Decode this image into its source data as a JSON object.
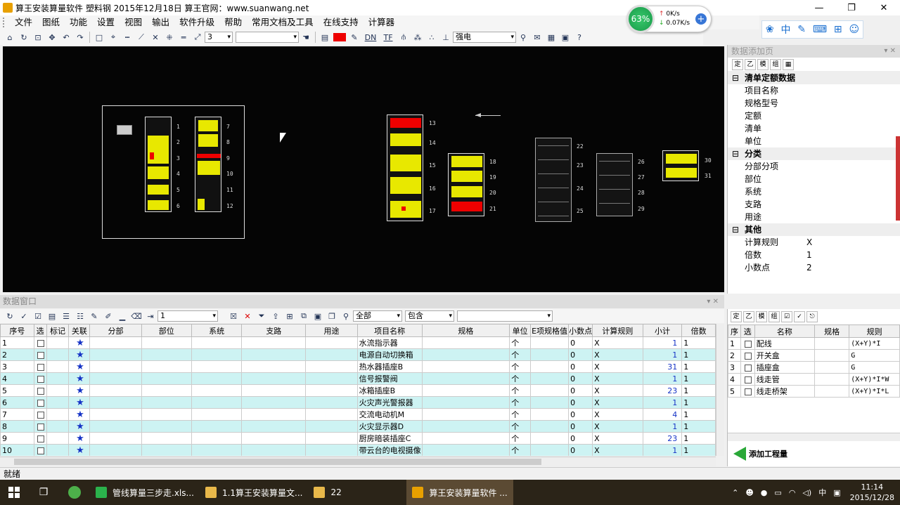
{
  "window": {
    "title": "算王安装算量软件 塑料钢 2015年12月18日  算王官网：www.suanwang.net",
    "min_label": "—",
    "restore_label": "❐",
    "close_label": "✕"
  },
  "menu": [
    "文件",
    "图纸",
    "功能",
    "设置",
    "视图",
    "输出",
    "软件升级",
    "帮助",
    "常用文档及工具",
    "在线支持",
    "计算器"
  ],
  "toolbar": {
    "layer_value": "3",
    "type_value": "强电",
    "dn_label": "DN",
    "tf_label": "TF"
  },
  "network": {
    "percent": "63%",
    "up": "0K/s",
    "down": "0.07K/s"
  },
  "ime": {
    "lang": "中"
  },
  "drawing": {
    "sheet_numbers": [
      "1",
      "2",
      "3",
      "4",
      "5",
      "6",
      "7",
      "8",
      "9",
      "10",
      "11",
      "12",
      "13",
      "14",
      "15",
      "16",
      "17",
      "18",
      "19",
      "20",
      "21",
      "22",
      "23",
      "24",
      "25",
      "26",
      "27",
      "28",
      "29",
      "30",
      "31"
    ]
  },
  "right_panel": {
    "title": "数据添加页",
    "tool_labels": [
      "定",
      "乙",
      "模",
      "组"
    ],
    "groups": [
      {
        "name": "清单定额数据",
        "rows": [
          {
            "k": "项目名称",
            "v": ""
          },
          {
            "k": "规格型号",
            "v": ""
          },
          {
            "k": "定额",
            "v": ""
          },
          {
            "k": "清单",
            "v": ""
          },
          {
            "k": "单位",
            "v": ""
          }
        ]
      },
      {
        "name": "分类",
        "rows": [
          {
            "k": "分部分项",
            "v": ""
          },
          {
            "k": "部位",
            "v": ""
          },
          {
            "k": "系统",
            "v": ""
          },
          {
            "k": "支路",
            "v": ""
          },
          {
            "k": "用途",
            "v": ""
          }
        ]
      },
      {
        "name": "其他",
        "rows": [
          {
            "k": "计算规则",
            "v": "X"
          },
          {
            "k": "倍数",
            "v": "1"
          },
          {
            "k": "小数点",
            "v": "2"
          }
        ]
      }
    ]
  },
  "data_window": {
    "title": "数据窗口",
    "page_value": "1",
    "filter_value": "全部",
    "match_value": "包含",
    "columns": [
      "序号",
      "选",
      "标记",
      "关联",
      "分部",
      "部位",
      "系统",
      "支路",
      "用途",
      "项目名称",
      "规格",
      "单位",
      "E项规格值",
      "小数点",
      "计算规则",
      "小计",
      "倍数"
    ],
    "rows": [
      {
        "no": "1",
        "name": "水流指示器",
        "unit": "个",
        "dec": "0",
        "rule": "X",
        "sub": "1",
        "mul": "1"
      },
      {
        "no": "2",
        "name": "电源自动切换箱",
        "unit": "个",
        "dec": "0",
        "rule": "X",
        "sub": "1",
        "mul": "1"
      },
      {
        "no": "3",
        "name": "热水器插座B",
        "unit": "个",
        "dec": "0",
        "rule": "X",
        "sub": "31",
        "mul": "1"
      },
      {
        "no": "4",
        "name": "信号报警阀",
        "unit": "个",
        "dec": "0",
        "rule": "X",
        "sub": "1",
        "mul": "1"
      },
      {
        "no": "5",
        "name": "冰箱插座B",
        "unit": "个",
        "dec": "0",
        "rule": "X",
        "sub": "23",
        "mul": "1"
      },
      {
        "no": "6",
        "name": "火灾声光警报器",
        "unit": "个",
        "dec": "0",
        "rule": "X",
        "sub": "1",
        "mul": "1"
      },
      {
        "no": "7",
        "name": "交流电动机M",
        "unit": "个",
        "dec": "0",
        "rule": "X",
        "sub": "4",
        "mul": "1"
      },
      {
        "no": "8",
        "name": "火灾显示器D",
        "unit": "个",
        "dec": "0",
        "rule": "X",
        "sub": "1",
        "mul": "1"
      },
      {
        "no": "9",
        "name": "厨房暗装插座C",
        "unit": "个",
        "dec": "0",
        "rule": "X",
        "sub": "23",
        "mul": "1"
      },
      {
        "no": "10",
        "name": "带云台的电视摄像",
        "unit": "个",
        "dec": "0",
        "rule": "X",
        "sub": "1",
        "mul": "1"
      }
    ]
  },
  "rule_panel": {
    "columns": [
      "序",
      "选",
      "名称",
      "规格",
      "规则"
    ],
    "rows": [
      {
        "no": "1",
        "name": "配线",
        "rule": "(X+Y)*I"
      },
      {
        "no": "2",
        "name": "开关盒",
        "rule": "G"
      },
      {
        "no": "3",
        "name": "插座盒",
        "rule": "G"
      },
      {
        "no": "4",
        "name": "线走管",
        "rule": "(X+Y)*I*W"
      },
      {
        "no": "5",
        "name": "线走桥架",
        "rule": "(X+Y)*I*L"
      }
    ],
    "add_label": "添加工程量"
  },
  "status": "就绪",
  "taskbar": {
    "tasks": [
      "管线算量三步走.xls...",
      "1.1算王安装算量文...",
      "22",
      "算王安装算量软件 ..."
    ],
    "ime": "中",
    "time": "11:14",
    "date": "2015/12/28"
  },
  "colors": {
    "canvas": "#050505",
    "highlight_row": "#cdf3f3",
    "accent": "#1533c6",
    "yellow": "#e8e800",
    "red": "#e00000"
  }
}
